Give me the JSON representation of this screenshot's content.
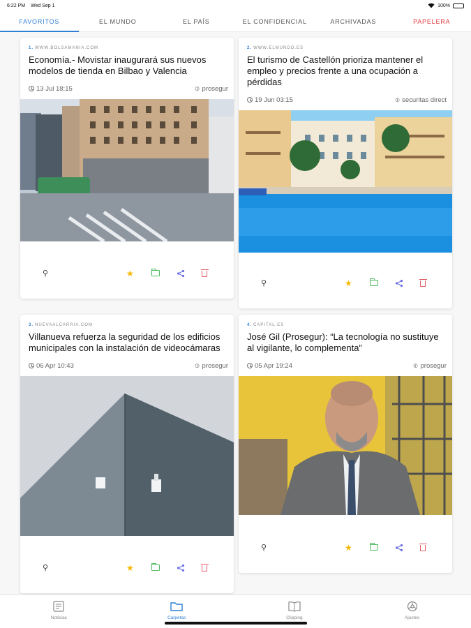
{
  "status_bar": {
    "time": "6:22 PM",
    "date": "Wed Sep 1",
    "battery": "100%"
  },
  "tabs": [
    {
      "label": "FAVORITOS",
      "active": true
    },
    {
      "label": "EL MUNDO"
    },
    {
      "label": "EL PAÍS"
    },
    {
      "label": "EL CONFIDENCIAL"
    },
    {
      "label": "ARCHIVADAS"
    },
    {
      "label": "PAPELERA",
      "color": "#e0393e"
    }
  ],
  "articles": [
    {
      "num": "1.",
      "source": "WWW.BOLSAMANIA.COM",
      "title": "Economía.- Movistar inaugurará sus nuevos modelos de tienda en Bilbao y Valencia",
      "date": "13 Jul 18:15",
      "tag": "prosegur"
    },
    {
      "num": "2.",
      "source": "WWW.ELMUNDO.ES",
      "title": "El turismo de Castellón prioriza mantener el empleo y precios frente a una ocupación a pérdidas",
      "date": "19 Jun 03:15",
      "tag": "securitas direct"
    },
    {
      "num": "3.",
      "source": "NUEVAALCARRIA.COM",
      "title": "Villanueva refuerza la seguridad de los edificios municipales con la instalación de videocámaras",
      "date": "06 Apr 10:43",
      "tag": "prosegur"
    },
    {
      "num": "4.",
      "source": "CAPITAL.ES",
      "title": "José Gil (Prosegur): “La tecnología no sustituye al vigilante, lo complementa”",
      "date": "05 Apr 19:24",
      "tag": "prosegur"
    }
  ],
  "tabbar": [
    {
      "label": "Noticias",
      "icon": "newspaper-icon"
    },
    {
      "label": "Carpetas",
      "icon": "folder-icon",
      "active": true
    },
    {
      "label": "Clipping",
      "icon": "book-icon"
    },
    {
      "label": "Ajustes",
      "icon": "gear-icon"
    }
  ],
  "colors": {
    "accent": "#2f7fd4",
    "danger": "#e0393e",
    "star": "#f5b800",
    "folder": "#4dbb5f",
    "share": "#6a6ee0",
    "trash": "#e45b65"
  }
}
